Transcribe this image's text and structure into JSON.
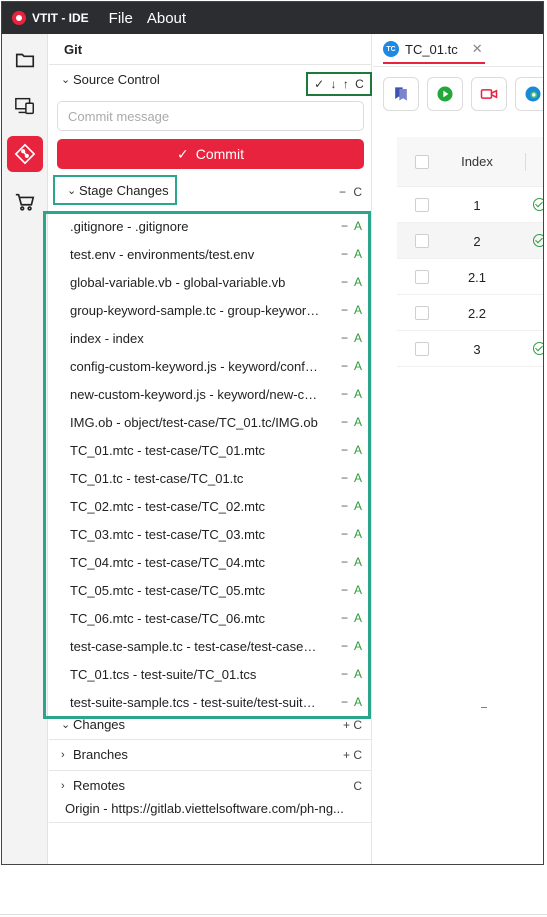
{
  "titlebar": {
    "app_name": "VTIT - IDE",
    "menus": [
      "File",
      "About"
    ]
  },
  "activity_bar": [
    "explorer-icon",
    "devices-icon",
    "git-icon",
    "cart-icon"
  ],
  "sidebar": {
    "title": "Git",
    "source_control": {
      "label": "Source Control",
      "actions": [
        "✓",
        "↓",
        "↑",
        "C"
      ]
    },
    "commit": {
      "placeholder": "Commit message",
      "button_label": "Commit"
    },
    "stage_changes": {
      "label": "Stage Changes",
      "actions": "− C",
      "files": [
        {
          "label": ".gitignore - .gitignore",
          "status": "A"
        },
        {
          "label": "test.env - environments/test.env",
          "status": "A"
        },
        {
          "label": "global-variable.vb - global-variable.vb",
          "status": "A"
        },
        {
          "label": "group-keyword-sample.tc - group-keyword-sample.tc",
          "status": "A"
        },
        {
          "label": "index - index",
          "status": "A"
        },
        {
          "label": "config-custom-keyword.js - keyword/config-custom-keyword.js",
          "status": "A"
        },
        {
          "label": "new-custom-keyword.js - keyword/new-custom-keyword.js",
          "status": "A"
        },
        {
          "label": "IMG.ob - object/test-case/TC_01.tc/IMG.ob",
          "status": "A"
        },
        {
          "label": "TC_01.mtc - test-case/TC_01.mtc",
          "status": "A"
        },
        {
          "label": "TC_01.tc - test-case/TC_01.tc",
          "status": "A"
        },
        {
          "label": "TC_02.mtc - test-case/TC_02.mtc",
          "status": "A"
        },
        {
          "label": "TC_03.mtc - test-case/TC_03.mtc",
          "status": "A"
        },
        {
          "label": "TC_04.mtc - test-case/TC_04.mtc",
          "status": "A"
        },
        {
          "label": "TC_05.mtc - test-case/TC_05.mtc",
          "status": "A"
        },
        {
          "label": "TC_06.mtc - test-case/TC_06.mtc",
          "status": "A"
        },
        {
          "label": "test-case-sample.tc - test-case/test-case-sample.tc",
          "status": "A"
        },
        {
          "label": "TC_01.tcs - test-suite/TC_01.tcs",
          "status": "A"
        },
        {
          "label": "test-suite-sample.tcs - test-suite/test-suite-sample.tcs",
          "status": "A"
        }
      ]
    },
    "changes": {
      "label": "Changes",
      "actions": "+ C"
    },
    "branches": {
      "label": "Branches",
      "actions": "+ C"
    },
    "remotes": {
      "label": "Remotes",
      "actions": "C",
      "origin": "Origin - https://gitlab.viettelsoftware.com/ph-ng..."
    }
  },
  "editor": {
    "tab": {
      "label": "TC_01.tc",
      "icon_text": "TC"
    },
    "toolbar": [
      "recorder-icon",
      "run-icon",
      "record-video-icon",
      "edge-browser-icon"
    ],
    "table": {
      "header": "Index",
      "rows": [
        {
          "index": "1",
          "ok": true
        },
        {
          "index": "2",
          "ok": true
        },
        {
          "index": "2.1",
          "ok": false
        },
        {
          "index": "2.2",
          "ok": false
        },
        {
          "index": "3",
          "ok": true
        }
      ]
    }
  },
  "colors": {
    "accent": "#e8233e",
    "highlight": "#2ca58d",
    "added": "#2c9c3a",
    "titlebar": "#2b2d31"
  }
}
